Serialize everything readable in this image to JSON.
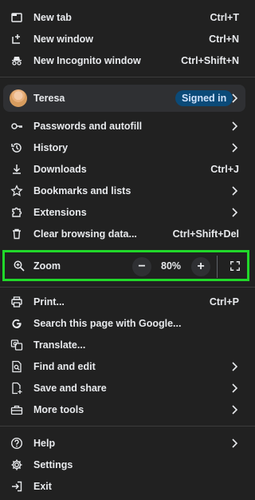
{
  "menu": {
    "new_tab": {
      "label": "New tab",
      "shortcut": "Ctrl+T",
      "icon": "new-tab-icon"
    },
    "new_window": {
      "label": "New window",
      "shortcut": "Ctrl+N",
      "icon": "new-window-icon"
    },
    "new_incognito": {
      "label": "New Incognito window",
      "shortcut": "Ctrl+Shift+N",
      "icon": "incognito-icon"
    },
    "profile": {
      "name": "Teresa",
      "status": "Signed in"
    },
    "passwords": {
      "label": "Passwords and autofill",
      "icon": "key-icon"
    },
    "history": {
      "label": "History",
      "icon": "history-icon"
    },
    "downloads": {
      "label": "Downloads",
      "shortcut": "Ctrl+J",
      "icon": "download-icon"
    },
    "bookmarks": {
      "label": "Bookmarks and lists",
      "icon": "star-icon"
    },
    "extensions": {
      "label": "Extensions",
      "icon": "puzzle-icon"
    },
    "clear_data": {
      "label": "Clear browsing data...",
      "shortcut": "Ctrl+Shift+Del",
      "icon": "trash-icon"
    },
    "zoom": {
      "label": "Zoom",
      "value": "80%",
      "minus": "−",
      "plus": "+"
    },
    "print": {
      "label": "Print...",
      "shortcut": "Ctrl+P",
      "icon": "print-icon"
    },
    "search_google": {
      "label": "Search this page with Google...",
      "icon": "google-g-icon"
    },
    "translate": {
      "label": "Translate...",
      "icon": "translate-icon"
    },
    "find_edit": {
      "label": "Find and edit",
      "icon": "find-icon"
    },
    "save_share": {
      "label": "Save and share",
      "icon": "save-share-icon"
    },
    "more_tools": {
      "label": "More tools",
      "icon": "toolbox-icon"
    },
    "help": {
      "label": "Help",
      "icon": "help-icon"
    },
    "settings": {
      "label": "Settings",
      "icon": "gear-icon"
    },
    "exit": {
      "label": "Exit",
      "icon": "exit-icon"
    }
  },
  "colors": {
    "background": "#212121",
    "text": "#e8eaed",
    "highlight_border": "#21d82a",
    "badge_bg": "#0b4a78"
  }
}
